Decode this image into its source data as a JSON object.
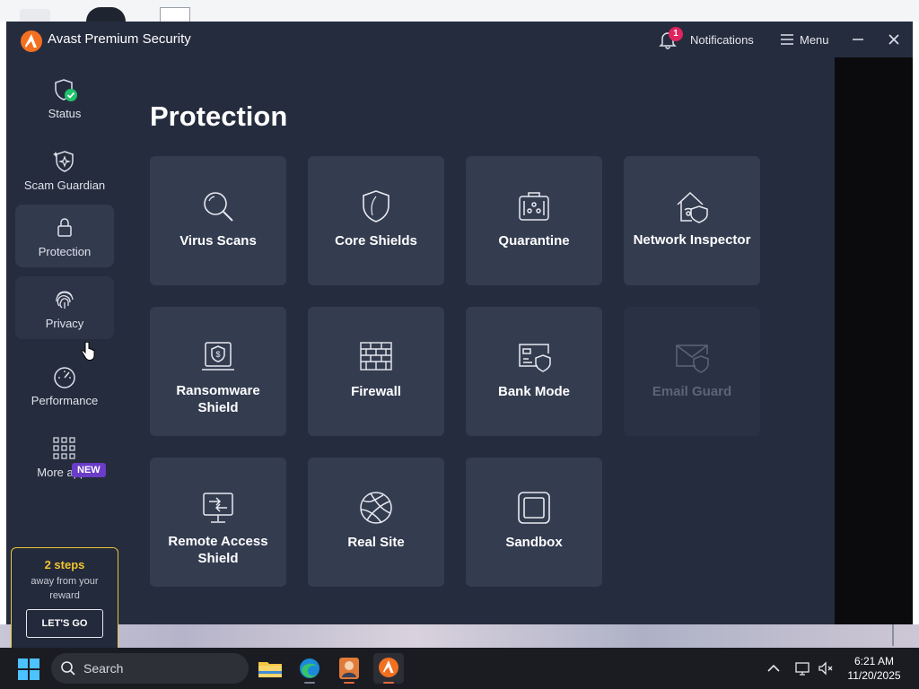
{
  "window": {
    "title": "Avast Premium Security",
    "notifications_label": "Notifications",
    "notifications_count": "1",
    "menu_label": "Menu"
  },
  "sidebar": {
    "items": [
      {
        "label": "Status",
        "icon": "shield-check-icon"
      },
      {
        "label": "Scam Guardian",
        "icon": "shield-sparkle-icon"
      },
      {
        "label": "Protection",
        "icon": "lock-icon"
      },
      {
        "label": "Privacy",
        "icon": "fingerprint-icon"
      },
      {
        "label": "Performance",
        "icon": "speedometer-icon"
      },
      {
        "label": "More apps",
        "icon": "grid-icon",
        "badge": "NEW"
      }
    ],
    "active_item": "Protection"
  },
  "promo": {
    "steps": "2 steps",
    "subtitle": "away from your reward",
    "button": "LET'S GO"
  },
  "main": {
    "title": "Protection",
    "tiles": [
      {
        "label": "Virus Scans",
        "icon": "magnifier-icon",
        "enabled": true
      },
      {
        "label": "Core Shields",
        "icon": "shield-icon",
        "enabled": true
      },
      {
        "label": "Quarantine",
        "icon": "quarantine-box-icon",
        "enabled": true
      },
      {
        "label": "Network Inspector",
        "icon": "home-shield-icon",
        "enabled": true
      },
      {
        "label": "Ransomware Shield",
        "icon": "laptop-dollar-icon",
        "enabled": true
      },
      {
        "label": "Firewall",
        "icon": "brick-wall-icon",
        "enabled": true
      },
      {
        "label": "Bank Mode",
        "icon": "card-shield-icon",
        "enabled": true
      },
      {
        "label": "Email Guard",
        "icon": "envelope-shield-icon",
        "enabled": false
      },
      {
        "label": "Remote Access Shield",
        "icon": "remote-monitor-icon",
        "enabled": true
      },
      {
        "label": "Real Site",
        "icon": "globe-icon",
        "enabled": true
      },
      {
        "label": "Sandbox",
        "icon": "sandbox-square-icon",
        "enabled": true
      }
    ]
  },
  "taskbar": {
    "search_label": "Search",
    "time": "6:21 AM",
    "date": "11/20/2025"
  },
  "colors": {
    "app_background": "#252c3e",
    "tile_background": "#343c50",
    "brand_orange": "#f37021",
    "promo_accent": "#f2c32e",
    "new_badge": "#6a3cc8",
    "status_ok": "#1ec26b"
  }
}
